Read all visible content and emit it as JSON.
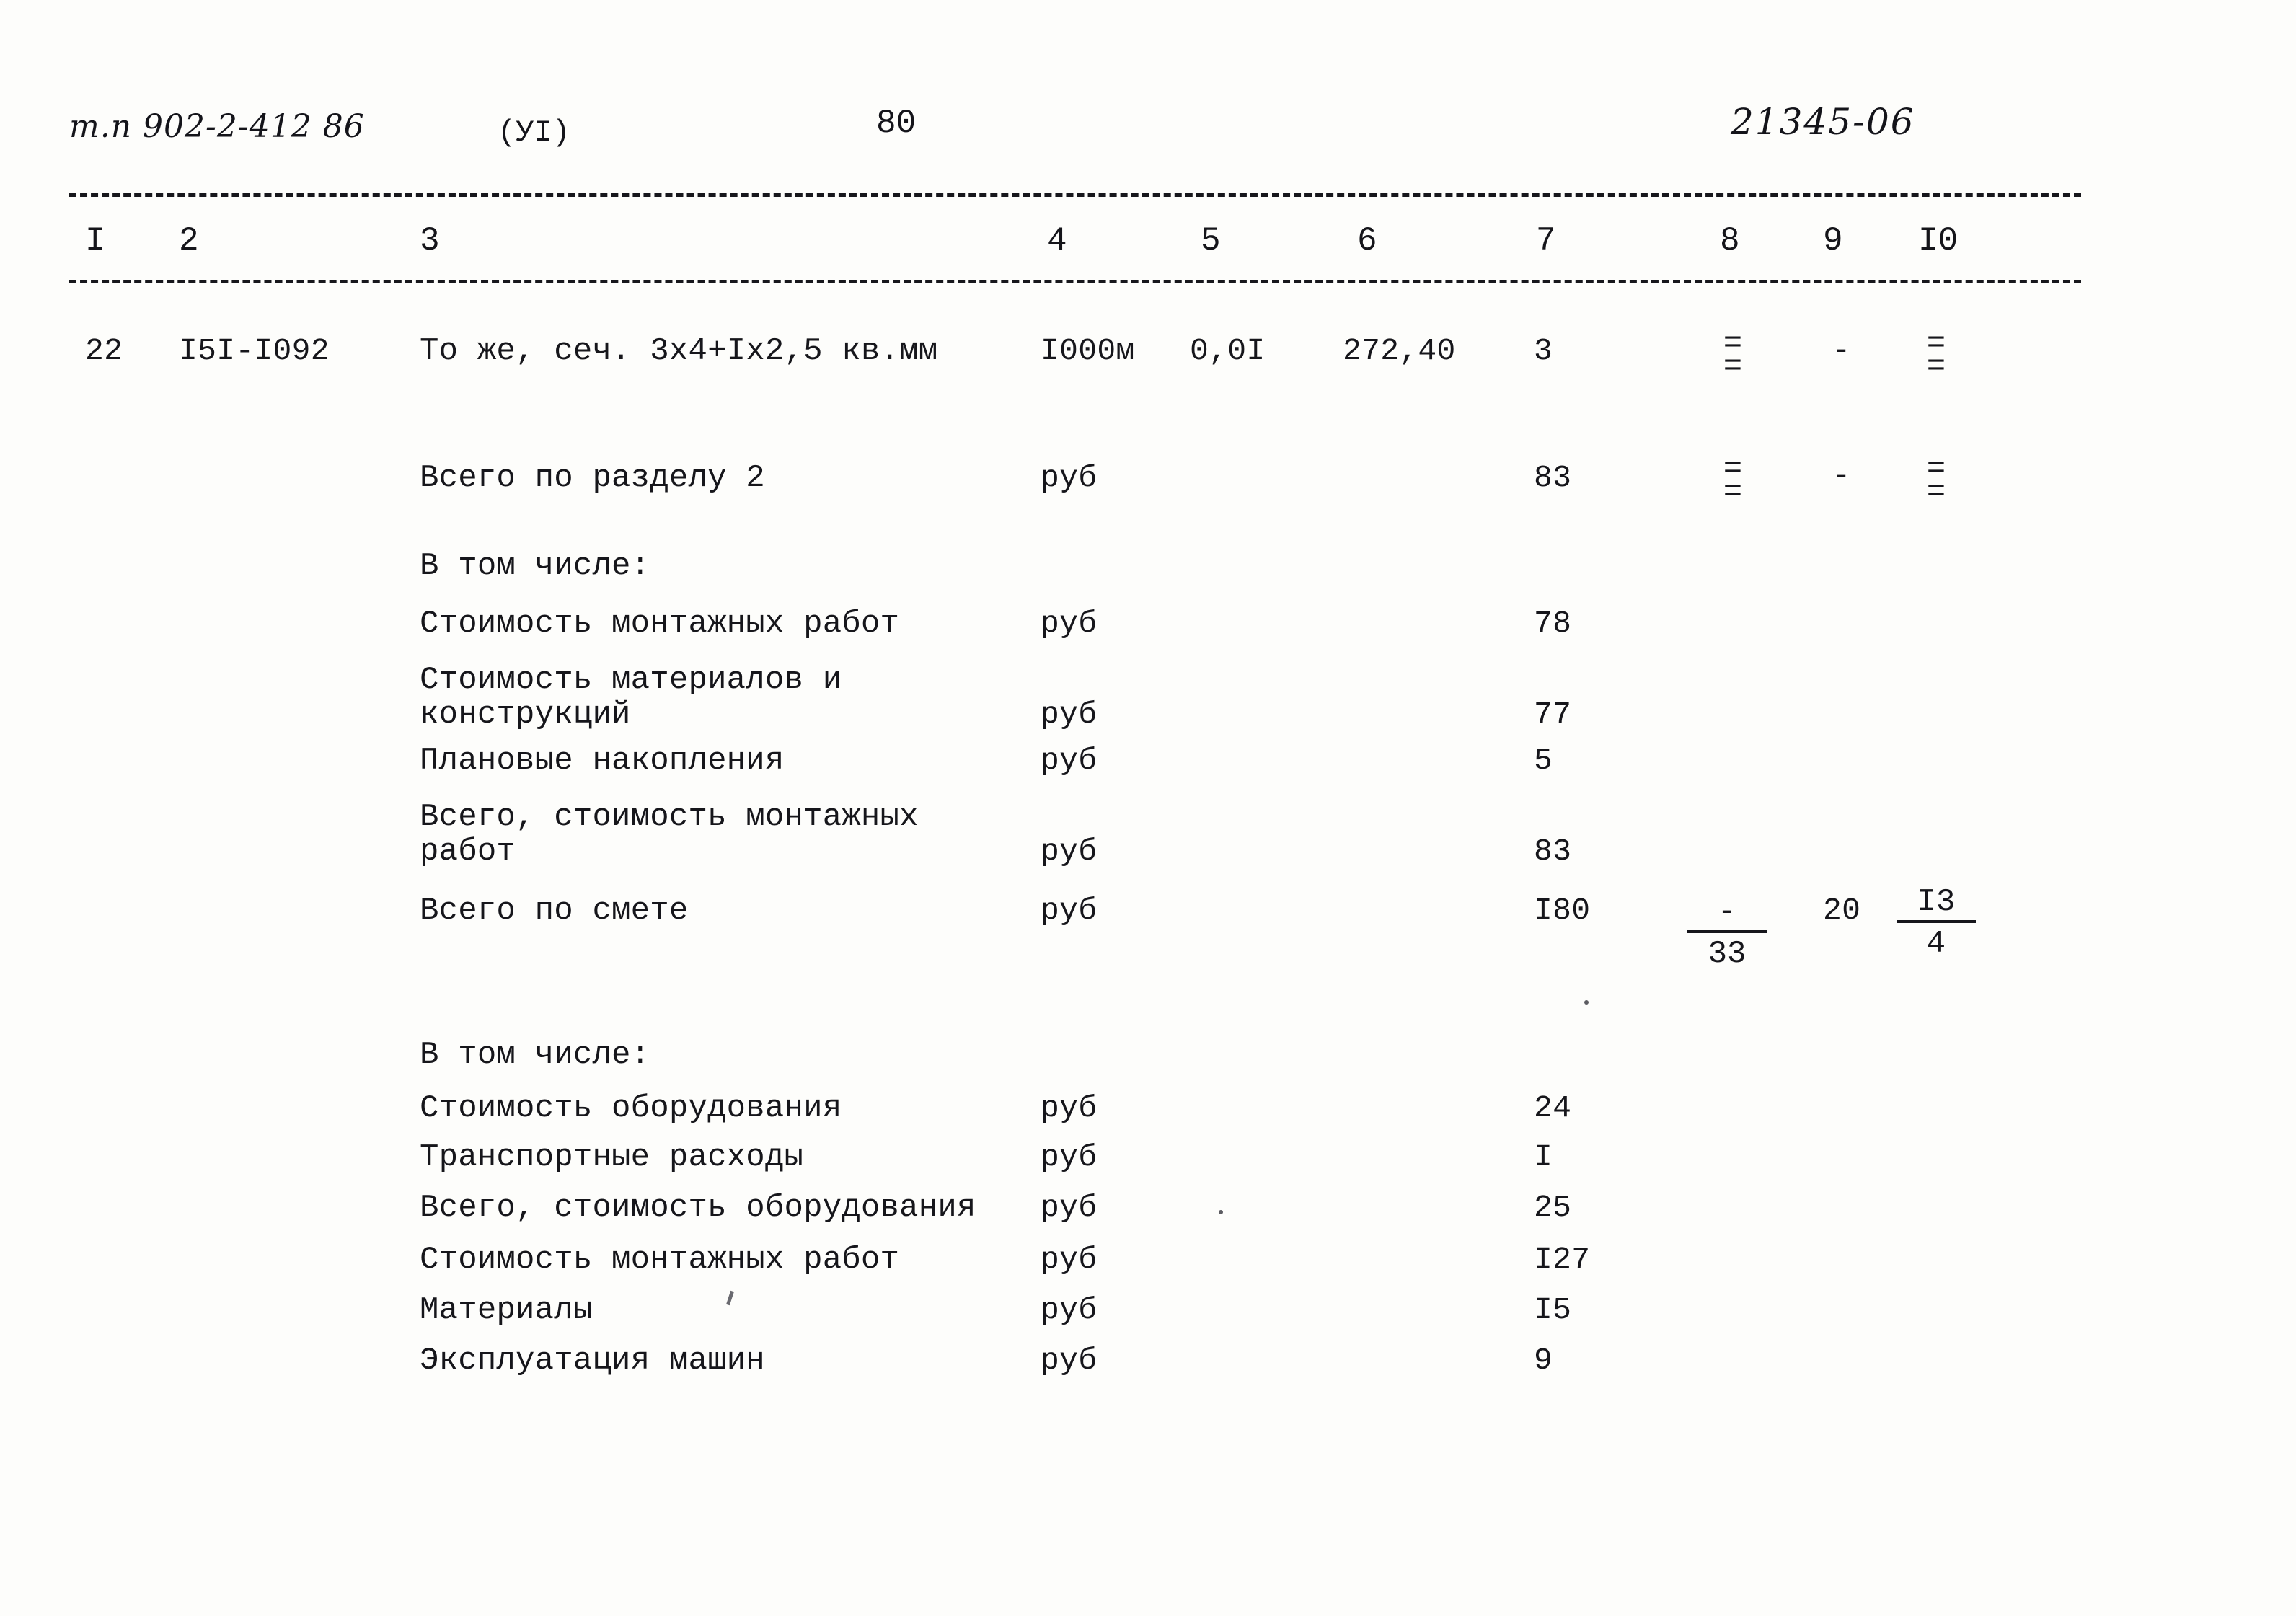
{
  "header": {
    "doc_code": "т.п 902-2-412 86",
    "section_roman": "(УI)",
    "page_number": "80",
    "right_code": "21345-06"
  },
  "table": {
    "column_numbers": [
      "I",
      "2",
      "3",
      "4",
      "5",
      "6",
      "7",
      "8",
      "9",
      "I0"
    ],
    "rows": [
      {
        "c1": "22",
        "c2": "I5I-I092",
        "c3": "То же, сеч. 3х4+Iх2,5 кв.мм",
        "c4": "I000м",
        "c5": "0,0I",
        "c6": "272,40",
        "c7": "3",
        "c8": "=",
        "c9": "-",
        "c10": "="
      },
      {
        "c3": "Всего по разделу 2",
        "c4": "руб",
        "c7": "83",
        "c8": "=",
        "c9": "-",
        "c10": "="
      },
      {
        "c3": "В том числе:"
      },
      {
        "c3": "Стоимость монтажных работ",
        "c4": "руб",
        "c7": "78"
      },
      {
        "c3": "Стоимость материалов и",
        "c3b": "конструкций",
        "c4": "руб",
        "c7": "77"
      },
      {
        "c3": "Плановые накопления",
        "c4": "руб",
        "c7": "5"
      },
      {
        "c3": "Всего, стоимость монтажных",
        "c3b": "работ",
        "c4": "руб",
        "c7": "83"
      },
      {
        "c3": "Всего по смете",
        "c4": "руб",
        "c7": "I80",
        "c8_num": "-",
        "c8_den": "33",
        "c9": "20",
        "c10_num": "I3",
        "c10_den": "4"
      },
      {
        "c3": "В том числе:"
      },
      {
        "c3": "Стоимость оборудования",
        "c4": "руб",
        "c7": "24"
      },
      {
        "c3": "Транспортные расходы",
        "c4": "руб",
        "c7": "I"
      },
      {
        "c3": "Всего, стоимость оборудования",
        "c4": "руб",
        "c7": "25"
      },
      {
        "c3": "Стоимость монтажных работ",
        "c4": "руб",
        "c7": "I27"
      },
      {
        "c3": "Материалы",
        "c4": "руб",
        "c7": "I5"
      },
      {
        "c3": "Эксплуатация машин",
        "c4": "руб",
        "c7": "9"
      }
    ]
  }
}
